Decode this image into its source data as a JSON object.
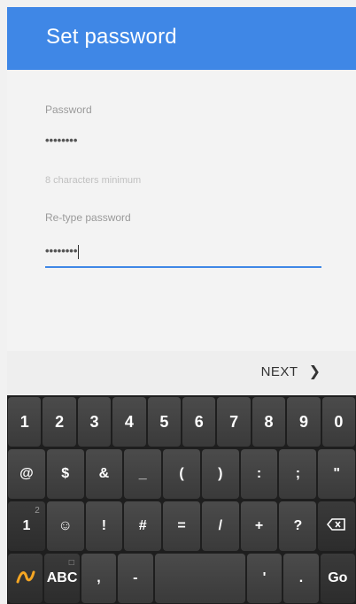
{
  "app_bar": {
    "title": "Set password"
  },
  "form": {
    "password_label": "Password",
    "password_value": "••••••••",
    "helper_text": "8 characters minimum",
    "retype_label": "Re-type password",
    "retype_value": "••••••••"
  },
  "nav": {
    "next_label": "NEXT",
    "next_icon": "chevron-right-icon"
  },
  "keyboard": {
    "row1": [
      "1",
      "2",
      "3",
      "4",
      "5",
      "6",
      "7",
      "8",
      "9",
      "0"
    ],
    "row2": [
      "@",
      "$",
      "&",
      "_",
      "(",
      ")",
      ":",
      ";",
      "\""
    ],
    "row3": [
      "#",
      "!",
      "#",
      "=",
      "/",
      "+",
      "?"
    ],
    "row3_emoji": "☺",
    "row3_sym": "1",
    "row3_sym_sub": "2",
    "row4_abc": "ABC",
    "row4_comma": ",",
    "row4_dash": "-",
    "row4_quote": "'",
    "row4_dot": ".",
    "row4_go": "Go",
    "accent_color": "#3f87e6"
  }
}
